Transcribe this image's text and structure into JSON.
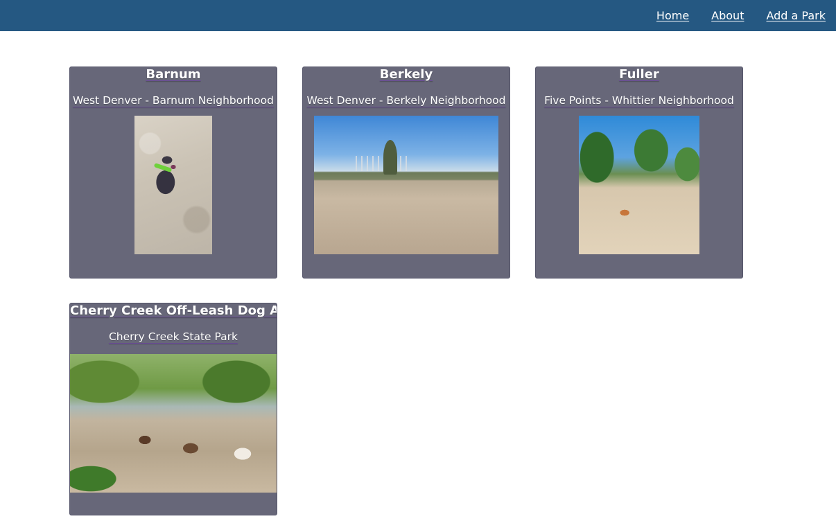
{
  "nav": {
    "links": [
      "Home",
      "About",
      "Add a Park"
    ]
  },
  "parks": [
    {
      "name": "Barnum",
      "neighborhood": "West Denver - Barnum Neighborhood",
      "photo_alt": "Dog sitting on sand"
    },
    {
      "name": "Berkely",
      "neighborhood": "West Denver - Berkely Neighborhood",
      "photo_alt": "Open sandy park field"
    },
    {
      "name": "Fuller",
      "neighborhood": "Five Points - Whittier Neighborhood",
      "photo_alt": "Dog in sandy fenced park"
    },
    {
      "name": "Cherry Creek Off-Leash Dog Area",
      "neighborhood": "Cherry Creek State Park",
      "photo_alt": "People and dogs at a creek"
    }
  ],
  "colors": {
    "header": "#255882",
    "card": "#676779"
  }
}
